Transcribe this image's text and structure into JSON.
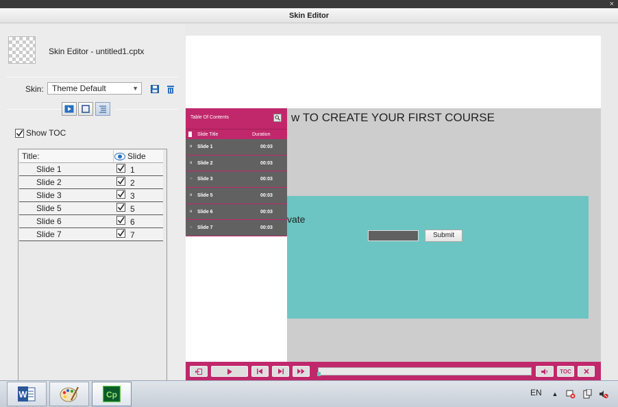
{
  "window": {
    "title": "Skin Editor",
    "close_glyph": "×"
  },
  "editor": {
    "file_title": "Skin Editor - untitled1.cptx",
    "skin_label": "Skin:",
    "skin_value": "Theme Default",
    "show_toc_label": "Show TOC",
    "show_toc_checked": true
  },
  "toc_table": {
    "columns": {
      "title": "Title:",
      "slide": "Slide"
    },
    "rows": [
      {
        "title": "Slide 1",
        "num": "1",
        "visible": true
      },
      {
        "title": "Slide 2",
        "num": "2",
        "visible": true
      },
      {
        "title": "Slide 3",
        "num": "3",
        "visible": true
      },
      {
        "title": "Slide 5",
        "num": "5",
        "visible": true
      },
      {
        "title": "Slide 6",
        "num": "6",
        "visible": true
      },
      {
        "title": "Slide 7",
        "num": "7",
        "visible": true
      }
    ]
  },
  "preview": {
    "course_title": "w TO CREATE YOUR FIRST COURSE",
    "teal_text": "vate",
    "submit_label": "Submit",
    "toc_panel": {
      "title": "Table Of Contents",
      "col_title": "Slide Title",
      "col_duration": "Duration",
      "rows": [
        {
          "status": "ıı",
          "name": "Slide 1",
          "duration": "00:03"
        },
        {
          "status": "ıı",
          "name": "Slide 2",
          "duration": "00:03"
        },
        {
          "status": "○",
          "name": "Slide 3",
          "duration": "00:03"
        },
        {
          "status": "ıı",
          "name": "Slide 5",
          "duration": "00:03"
        },
        {
          "status": "ıı",
          "name": "Slide 6",
          "duration": "00:03"
        },
        {
          "status": "○",
          "name": "Slide 7",
          "duration": "00:03"
        }
      ]
    },
    "playbar": {
      "toc_label": "TOC",
      "progress": 0
    },
    "colors": {
      "accent": "#c0286b",
      "teal": "#6cc5c2",
      "stage": "#cdcdcd"
    }
  },
  "taskbar": {
    "items": [
      {
        "name": "word",
        "glyph": "W"
      },
      {
        "name": "paint",
        "glyph": "🎨"
      },
      {
        "name": "captivate",
        "glyph": "Cp"
      }
    ],
    "language": "EN"
  }
}
